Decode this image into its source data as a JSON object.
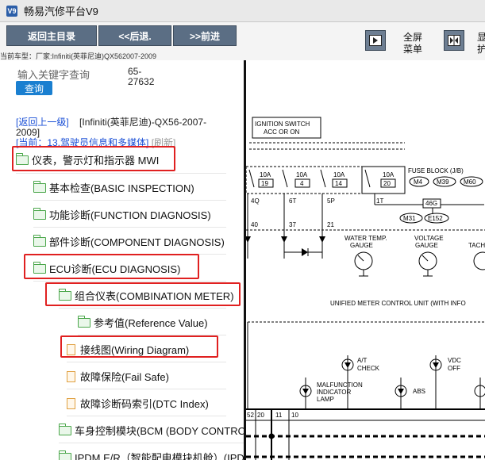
{
  "window": {
    "title": "畅易汽修平台V9",
    "icon_text": "V9"
  },
  "toolbar": {
    "home_label": "返回主目录",
    "back_label": "<<后退.",
    "forward_label": ">>前进",
    "fullscreen_label": "全屏",
    "menu_label": "菜单",
    "car_model": "当前车型：厂家:Infiniti(英菲尼迪)QX562007-2009"
  },
  "search": {
    "placeholder": "输入关键字查询",
    "code": "65-27632",
    "button": "查询"
  },
  "breadcrumb": {
    "back_link": "[返回上一级]",
    "model": "[Infiniti(英菲尼迪)-QX56-2007-2009]",
    "current": "[当前：13.驾驶员信息和多媒体]",
    "refresh": "[刷新]"
  },
  "tree": [
    {
      "label": "仪表，警示灯和指示器 MWI",
      "type": "folder"
    },
    {
      "label": "基本检查(BASIC INSPECTION)",
      "type": "folder"
    },
    {
      "label": "功能诊断(FUNCTION DIAGNOSIS)",
      "type": "folder"
    },
    {
      "label": "部件诊断(COMPONENT DIAGNOSIS)",
      "type": "folder"
    },
    {
      "label": "ECU诊断(ECU DIAGNOSIS)",
      "type": "folder"
    },
    {
      "label": "组合仪表(COMBINATION METER)",
      "type": "folder"
    },
    {
      "label": "参考值(Reference Value)",
      "type": "folder"
    },
    {
      "label": "接线图(Wiring Diagram)",
      "type": "doc"
    },
    {
      "label": "故障保险(Fail Safe)",
      "type": "doc"
    },
    {
      "label": "故障诊断码索引(DTC Index)",
      "type": "doc"
    },
    {
      "label": "车身控制模块(BCM (BODY CONTROL MODULE))",
      "type": "folder"
    },
    {
      "label": "IPDM E/R（智能配电模块机舱）(IPDM E/R)",
      "type": "folder"
    }
  ],
  "diagram": {
    "ignition_switch": "IGNITION SWITCH",
    "acc_or_on": "ACC OR ON",
    "fuse_block": "FUSE BLOCK (J/B)",
    "fuses": [
      {
        "amp": "10A",
        "num": "19"
      },
      {
        "amp": "10A",
        "num": "4"
      },
      {
        "amp": "10A",
        "num": "14"
      },
      {
        "amp": "10A",
        "num": "20"
      }
    ],
    "connectors": [
      "M4",
      "M39",
      "M60",
      "M31",
      "E152"
    ],
    "j_label": "46G",
    "wire_top": [
      "4Q",
      "6T",
      "5P",
      "1T"
    ],
    "wire_mid": [
      "40",
      "37",
      "21"
    ],
    "water_temp": "WATER TEMP.",
    "gauge": "GAUGE",
    "voltage": "VOLTAGE",
    "tach": "TACH",
    "unit_label": "UNIFIED METER CONTROL UNIT (WITH INFO",
    "at_check_1": "A/T",
    "at_check_2": "CHECK",
    "vdc_1": "VDC",
    "vdc_2": "OFF",
    "mil_1": "MALFUNCTION",
    "mil_2": "INDICATOR",
    "mil_3": "LAMP",
    "abs": "ABS",
    "bottom_pins": [
      "52",
      "20",
      "11",
      "10"
    ]
  }
}
